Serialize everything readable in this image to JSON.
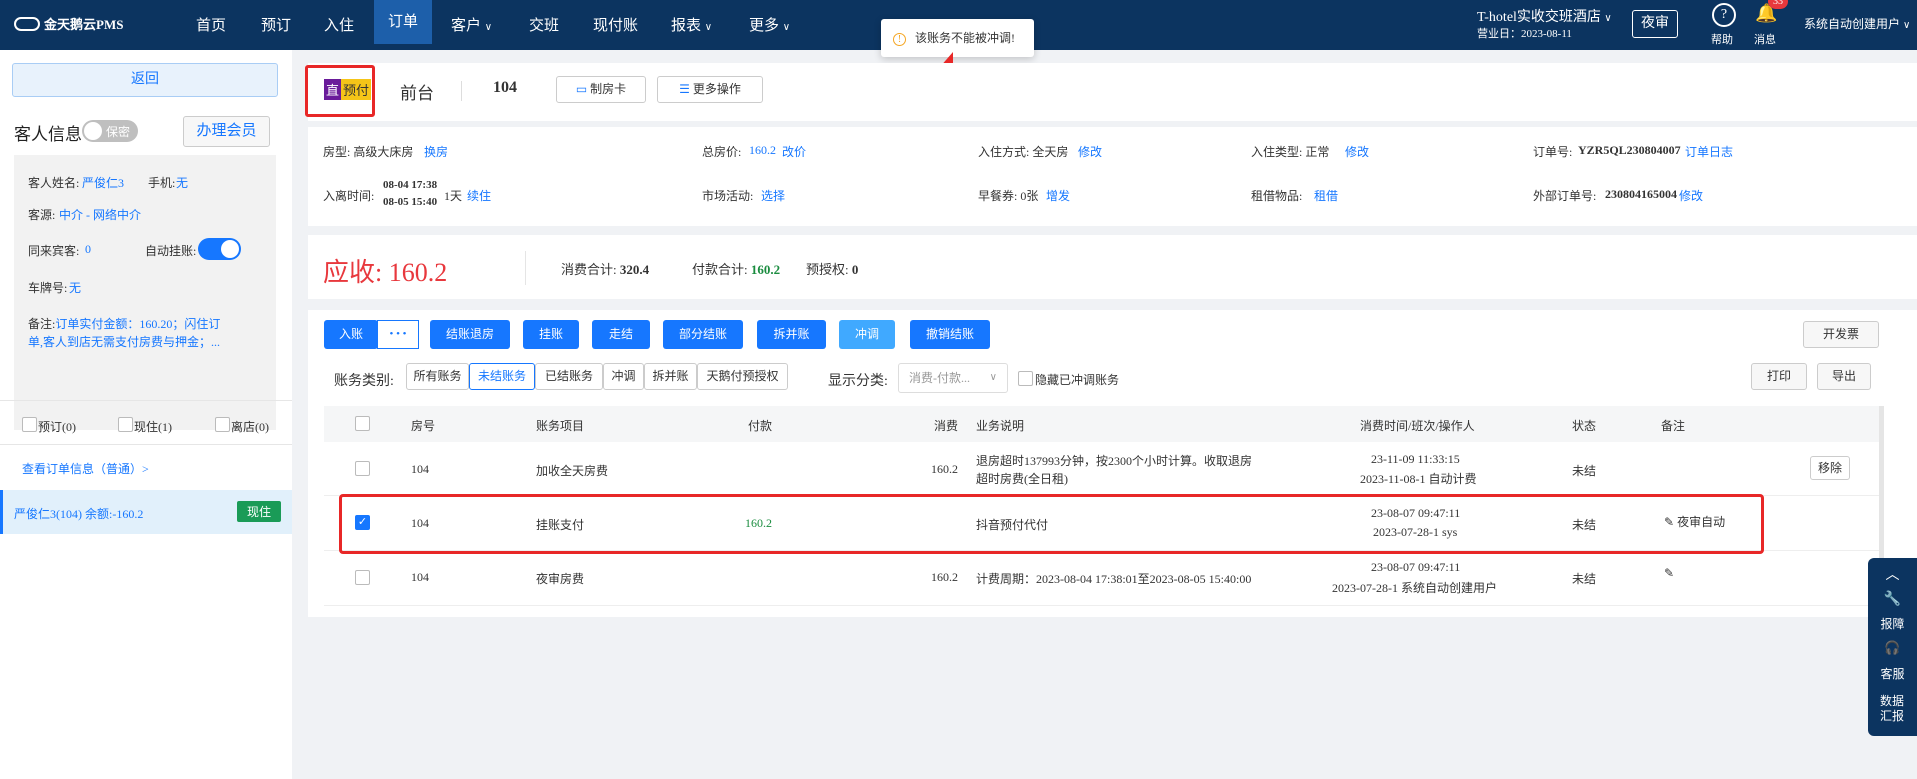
{
  "topnav": {
    "logo": "金天鹅云PMS",
    "items": [
      "首页",
      "预订",
      "入住",
      "订单",
      "客户",
      "交班",
      "现付账",
      "报表",
      "更多"
    ],
    "hotel": "T-hotel实收交班酒店",
    "business_day": "营业日：2023-08-11",
    "night_audit": "夜审",
    "help": "帮助",
    "messages": "消息",
    "msg_badge": "33",
    "user": "系统自动创建用户"
  },
  "toast": "该账务不能被冲调!",
  "left": {
    "back": "返回",
    "guest_info_title": "客人信息",
    "privacy_toggle": "保密",
    "member_btn": "办理会员",
    "guest_name_label": "客人姓名:",
    "guest_name": "严俊仁3",
    "phone_label": "手机:",
    "phone": "无",
    "source_label": "客源:",
    "source": "中介 - 网络中介",
    "companions_label": "同来宾客:",
    "companions": "0",
    "auto_charge_label": "自动挂账:",
    "plate_label": "车牌号:",
    "plate": "无",
    "remark_label": "备注:",
    "remark": "订单实付金额：160.20；闪住订单,客人到店无需支付房费与押金；...",
    "tabs": [
      "预订(0)",
      "现住(1)",
      "离店(0)"
    ],
    "view_order": "查看订单信息（普通）>",
    "guest_item": "严俊仁3(104)   余额:-160.2",
    "guest_status": "现住"
  },
  "header": {
    "badge_direct": "直",
    "badge_prepaid": "预付",
    "channel": "前台",
    "room": "104",
    "make_card": "制房卡",
    "more_ops": "更多操作"
  },
  "info": {
    "room_type_label": "房型:",
    "room_type": "高级大床房",
    "change_room": "换房",
    "total_price_label": "总房价:",
    "total_price": "160.2",
    "change_price": "改价",
    "checkin_mode_label": "入住方式:",
    "checkin_mode": "全天房",
    "modify1": "修改",
    "checkin_type_label": "入住类型:",
    "checkin_type": "正常",
    "modify2": "修改",
    "order_no_label": "订单号:",
    "order_no": "YZR5QL230804007",
    "order_log": "订单日志",
    "time_label": "入离时间:",
    "time_in": "08-04 17:38",
    "time_out": "08-05 15:40",
    "nights": "1天",
    "extend": "续住",
    "market_label": "市场活动:",
    "market": "选择",
    "breakfast_label": "早餐券:",
    "breakfast": "0张",
    "breakfast_add": "增发",
    "rental_label": "租借物品:",
    "rental": "租借",
    "ext_order_label": "外部订单号:",
    "ext_order": "230804165004",
    "modify3": "修改"
  },
  "summary": {
    "due_label": "应收:",
    "due": "160.2",
    "consume_label": "消费合计:",
    "consume": "320.4",
    "pay_label": "付款合计:",
    "pay": "160.2",
    "preauth_label": "预授权:",
    "preauth": "0"
  },
  "actions": {
    "post": "入账",
    "more": "• • •",
    "checkout": "结账退房",
    "charge": "挂账",
    "walk": "走结",
    "partial": "部分结账",
    "split": "拆并账",
    "reverse": "冲调",
    "cancel": "撤销结账",
    "invoice": "开发票"
  },
  "filters": {
    "type_label": "账务类别:",
    "types": [
      "所有账务",
      "未结账务",
      "已结账务",
      "冲调",
      "拆并账",
      "天鹅付预授权"
    ],
    "display_label": "显示分类:",
    "display_value": "消费-付款...",
    "hide_reversed": "隐藏已冲调账务",
    "print": "打印",
    "export": "导出"
  },
  "table": {
    "headers": [
      "房号",
      "账务项目",
      "付款",
      "消费",
      "业务说明",
      "消费时间/班次/操作人",
      "状态",
      "备注"
    ],
    "rows": [
      {
        "room": "104",
        "item": "加收全天房费",
        "pay": "",
        "consume": "160.2",
        "desc1": "退房超时137993分钟，按2300个小时计算。收取退房",
        "desc2": "超时房费(全日租)",
        "time1": "23-11-09 11:33:15",
        "time2": "2023-11-08-1 自动计费",
        "status": "未结",
        "remark": "",
        "action": "移除"
      },
      {
        "room": "104",
        "item": "挂账支付",
        "pay": "160.2",
        "consume": "",
        "desc1": "抖音预付代付",
        "desc2": "",
        "time1": "23-08-07 09:47:11",
        "time2": "2023-07-28-1 sys",
        "status": "未结",
        "remark": "夜审自动",
        "action": ""
      },
      {
        "room": "104",
        "item": "夜审房费",
        "pay": "",
        "consume": "160.2",
        "desc1": "计费周期：2023-08-04 17:38:01至2023-08-05 15:40:00",
        "desc2": "",
        "time1": "23-08-07 09:47:11",
        "time2": "2023-07-28-1 系统自动创建用户",
        "status": "未结",
        "remark": "",
        "action": ""
      }
    ]
  },
  "float_panel": {
    "report": "报障",
    "service": "客服",
    "data": "数据汇报"
  },
  "colors": {
    "nav_bg": "#0c3460",
    "primary": "#1677ff",
    "due_red": "#e8383d",
    "highlight_red": "#e82727",
    "pay_green": "#1a8c3f"
  }
}
